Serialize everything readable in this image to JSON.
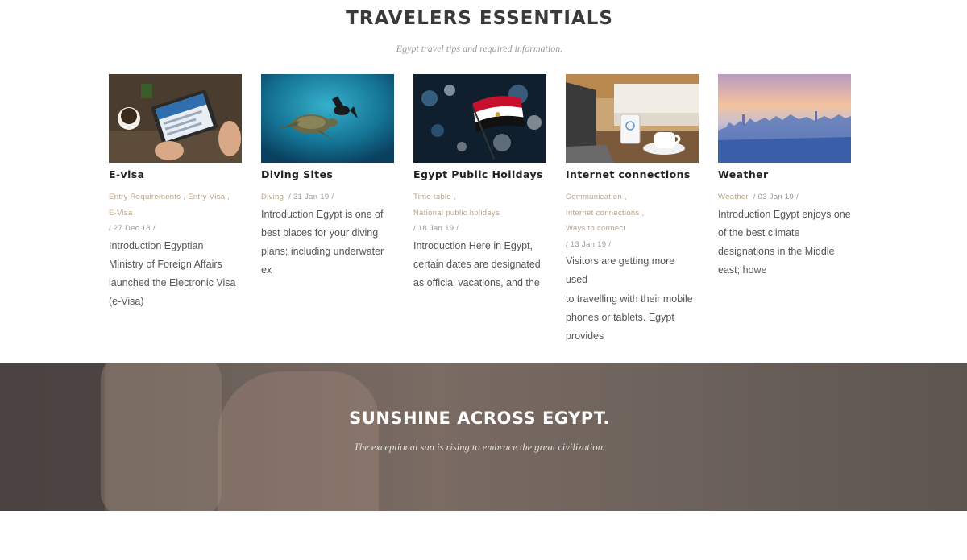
{
  "section": {
    "title": "TRAVELERS ESSENTIALS",
    "subtitle": "Egypt travel tips and required information."
  },
  "cards": [
    {
      "title": "E-visa",
      "image": "visa-application-tablet-image",
      "categories": [
        "Entry Requirements",
        "Entry Visa",
        "E-Visa"
      ],
      "date": "/ 27 Dec 18 /",
      "excerpt_lines": [
        "Introduction Egyptian",
        "Ministry of Foreign Affairs",
        "launched the Electronic Visa",
        "(e-Visa)"
      ]
    },
    {
      "title": "Diving Sites",
      "image": "diver-with-turtle-image",
      "categories": [
        "Diving"
      ],
      "date": "/ 31 Jan 19 /",
      "excerpt_lines": [
        "Introduction Egypt is one of",
        "best places for your diving",
        "plans; including underwater",
        "ex"
      ]
    },
    {
      "title": "Egypt Public Holidays",
      "image": "egypt-flag-image",
      "categories": [
        "Time table",
        "National public holidays"
      ],
      "date": "/ 18 Jan 19 /",
      "excerpt_lines": [
        "Introduction Here in Egypt,",
        "certain dates are designated",
        "as official vacations, and the"
      ]
    },
    {
      "title": "Internet connections",
      "image": "laptop-wifi-coffee-image",
      "categories": [
        "Communication",
        "Internet connections",
        "Ways to connect"
      ],
      "date": "/ 13 Jan 19 /",
      "excerpt_lines": [
        "Visitors are getting more used",
        "to travelling with their mobile",
        "phones or tablets. Egypt",
        "provides"
      ]
    },
    {
      "title": "Weather",
      "image": "city-skyline-sunset-image",
      "categories": [
        "Weather"
      ],
      "date": "/ 03 Jan 19 /",
      "excerpt_lines": [
        "Introduction Egypt enjoys one",
        "of the best climate",
        "designations in the Middle",
        "east; howe"
      ]
    }
  ],
  "banner": {
    "title": "SUNSHINE ACROSS EGYPT.",
    "subtitle": "The exceptional sun is rising to embrace the great civilization."
  },
  "colors": {
    "category_link": "#b8a48c",
    "banner_overlay": "#6a5f59"
  }
}
